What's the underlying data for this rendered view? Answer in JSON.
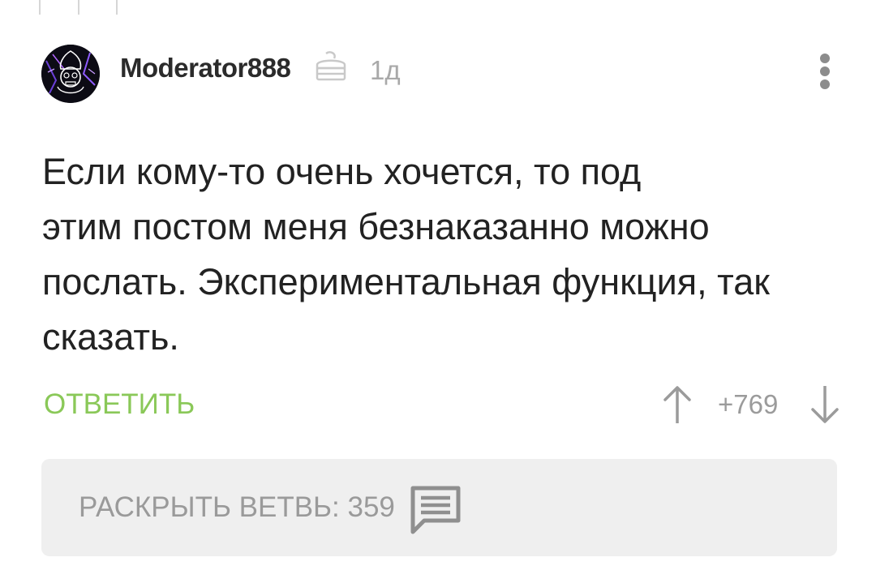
{
  "comment": {
    "author": "Moderator888",
    "time": "1д",
    "text": "Если кому-то очень хочется, то под\nэтим постом меня безнаказанно можно\nпослать. Экспериментальная функция, так\nсказать.",
    "reply_label": "ОТВЕТИТЬ",
    "rating": "+769",
    "expand_label": "РАСКРЫТЬ ВЕТВЬ: 359"
  },
  "colors": {
    "accent_green": "#8ac858",
    "muted_gray": "#9b9b9b",
    "panel_bg": "#efefef"
  },
  "icons": {
    "badge": "cake-icon",
    "more": "more-vertical-icon",
    "upvote": "arrow-up-icon",
    "downvote": "arrow-down-icon",
    "comments": "comments-icon"
  }
}
